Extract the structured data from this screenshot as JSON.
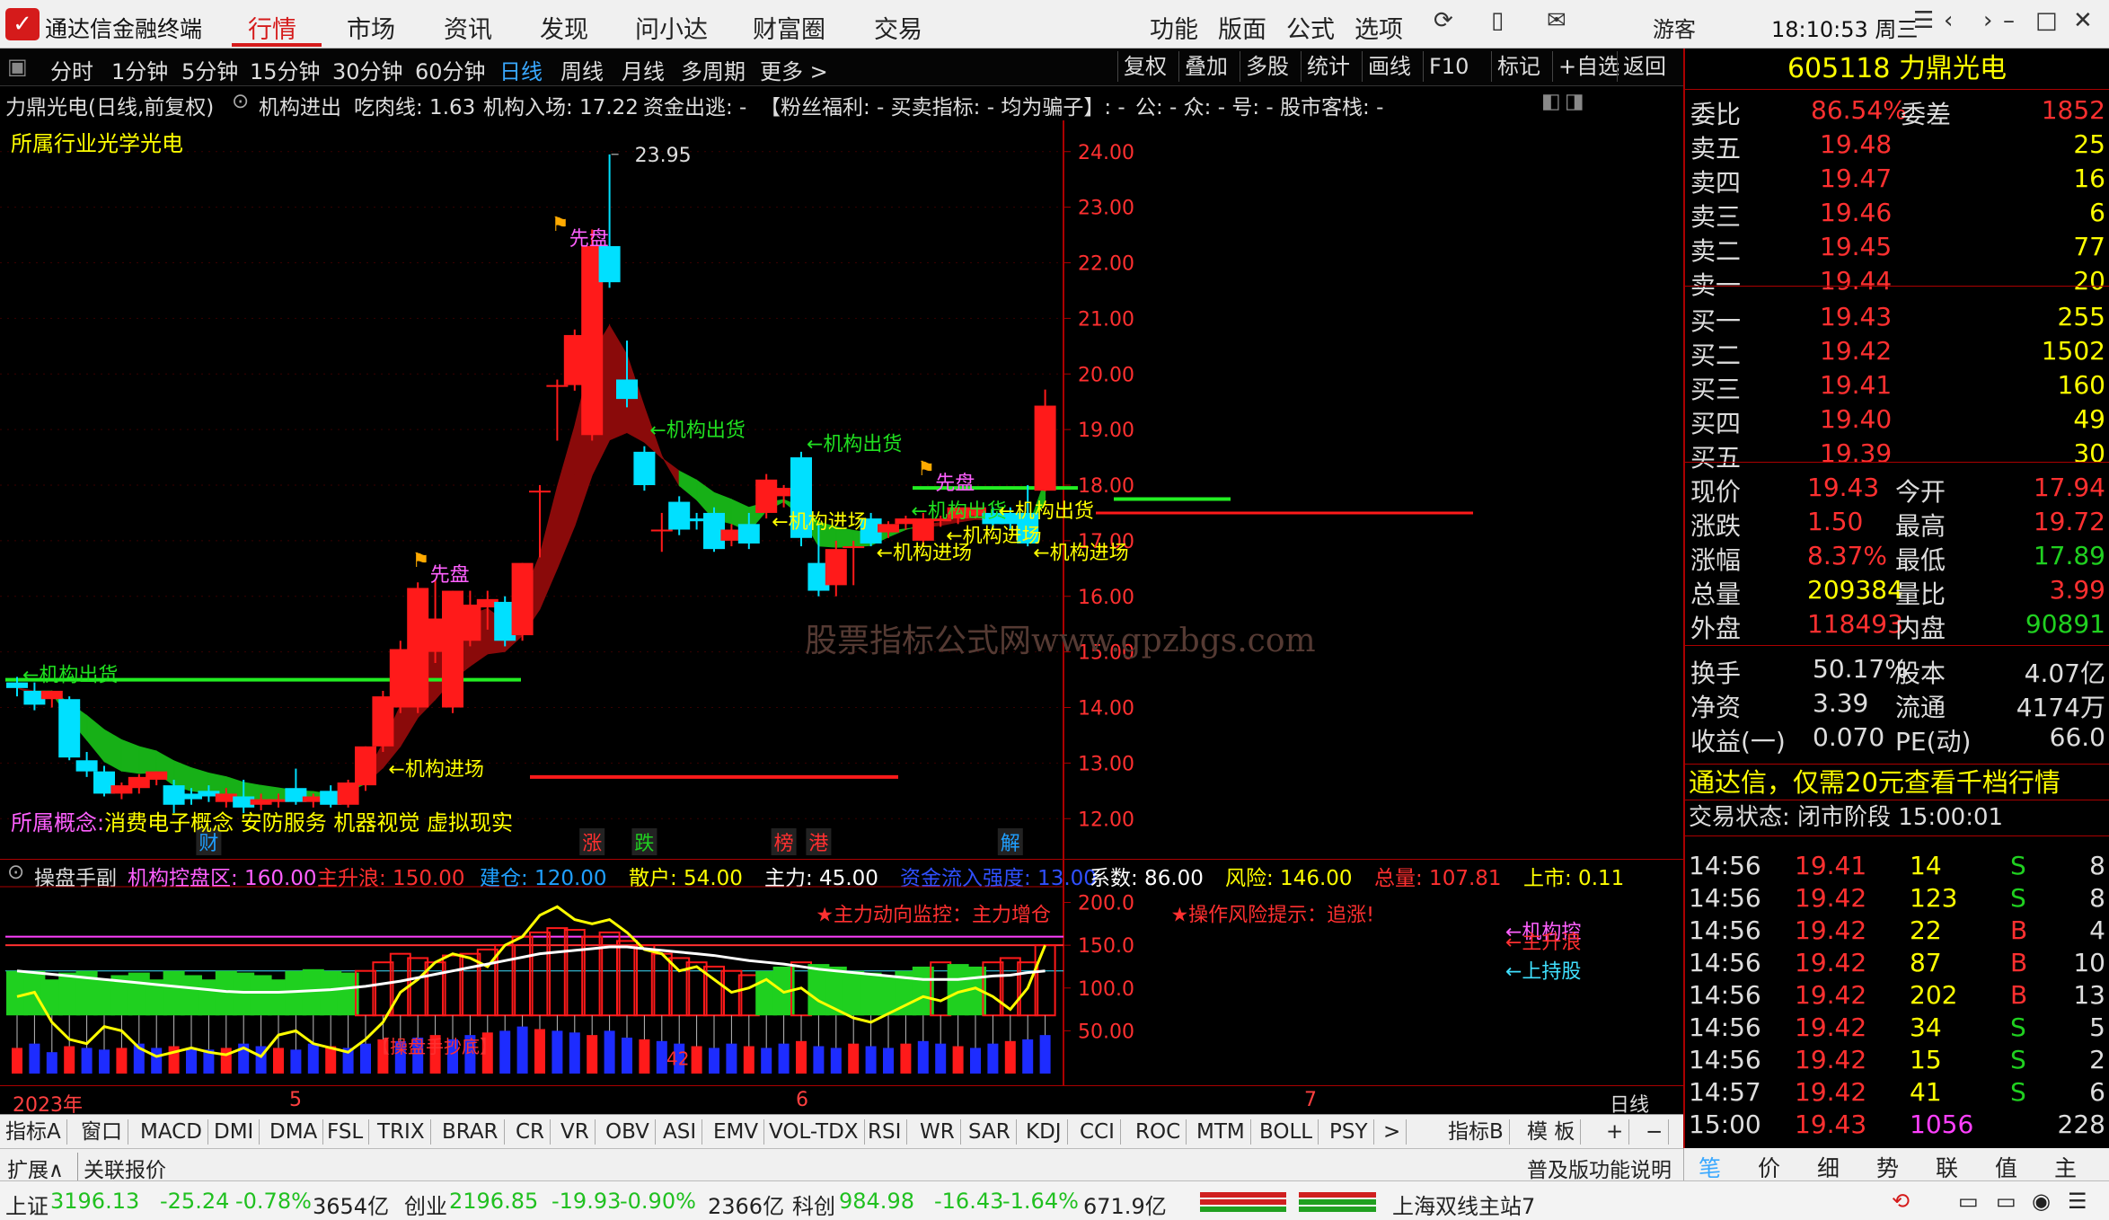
{
  "app": {
    "name": "通达信金融终端",
    "menus": [
      "行情",
      "市场",
      "资讯",
      "发现",
      "问小达",
      "财富圈",
      "交易"
    ],
    "right_menus": [
      "功能",
      "版面",
      "公式",
      "选项"
    ],
    "user": "游客",
    "clock": "18:10:53 周三"
  },
  "chart_toolbar": {
    "periods": [
      "分时",
      "1分钟",
      "5分钟",
      "15分钟",
      "30分钟",
      "60分钟",
      "日线",
      "周线",
      "月线",
      "多周期",
      "更多 >"
    ],
    "selected_period": "日线",
    "right_buttons": [
      "复权",
      "叠加",
      "多股",
      "统计",
      "画线",
      "F10",
      "标记",
      "+自选",
      "返回"
    ]
  },
  "info_line": {
    "stock": "力鼎光电(日线,前复权)",
    "indicator": "机构进出",
    "items": [
      {
        "text": "吃肉线: 1.63",
        "color": "#ffffff"
      },
      {
        "text": "机构入场: 17.22",
        "color": "#ff3030"
      },
      {
        "text": "资金出逃: -",
        "color": "#20d020"
      },
      {
        "text": "【粉丝福利: - 买卖指标: - 均为骗子】: -",
        "color": "#ffff00"
      },
      {
        "text": "公: - 众: - 号: - 股市客栈: -",
        "color": "#ffffff"
      }
    ],
    "industry": "所属行业光学光电",
    "concept_label": "所属概念:",
    "concepts": "消费电子概念 安防服务 机器视觉 虚拟现实"
  },
  "chart_data": [
    {
      "type": "candlestick",
      "title": "力鼎光电(日线,前复权)",
      "y_ticks": [
        24.0,
        23.0,
        22.0,
        21.0,
        20.0,
        19.0,
        18.0,
        17.0,
        16.0,
        15.0,
        14.0,
        13.0,
        12.0
      ],
      "y_tick_labels": [
        "24.00",
        "23.00",
        "22.00",
        "21.00",
        "20.00",
        "19.00",
        "18.00",
        "17.00",
        "16.00",
        "15.00",
        "14.00",
        "13.00",
        "12.00"
      ],
      "ylim": [
        11.6,
        24.4
      ],
      "max_label": "23.95",
      "candles": [
        {
          "o": 14.45,
          "h": 14.55,
          "c": 14.35,
          "l": 14.2
        },
        {
          "o": 14.3,
          "h": 14.45,
          "c": 14.05,
          "l": 13.95
        },
        {
          "o": 14.15,
          "h": 14.3,
          "c": 14.3,
          "l": 14.0
        },
        {
          "o": 14.15,
          "h": 14.2,
          "c": 13.1,
          "l": 13.05
        },
        {
          "o": 13.05,
          "h": 13.2,
          "c": 12.85,
          "l": 12.75
        },
        {
          "o": 12.85,
          "h": 12.95,
          "c": 12.45,
          "l": 12.4
        },
        {
          "o": 12.45,
          "h": 12.65,
          "c": 12.6,
          "l": 12.35
        },
        {
          "o": 12.55,
          "h": 12.8,
          "c": 12.75,
          "l": 12.45
        },
        {
          "o": 12.7,
          "h": 12.85,
          "c": 12.85,
          "l": 12.6
        },
        {
          "o": 12.6,
          "h": 12.7,
          "c": 12.25,
          "l": 12.1
        },
        {
          "o": 12.45,
          "h": 12.55,
          "c": 12.35,
          "l": 12.25
        },
        {
          "o": 12.5,
          "h": 12.6,
          "c": 12.4,
          "l": 12.3
        },
        {
          "o": 12.3,
          "h": 12.55,
          "c": 12.45,
          "l": 12.2
        },
        {
          "o": 12.4,
          "h": 12.7,
          "c": 12.2,
          "l": 12.1
        },
        {
          "o": 12.25,
          "h": 12.45,
          "c": 12.35,
          "l": 12.15
        },
        {
          "o": 12.3,
          "h": 12.45,
          "c": 12.35,
          "l": 12.2
        },
        {
          "o": 12.55,
          "h": 12.9,
          "c": 12.3,
          "l": 12.25
        },
        {
          "o": 12.3,
          "h": 12.45,
          "c": 12.4,
          "l": 12.2
        },
        {
          "o": 12.5,
          "h": 12.6,
          "c": 12.25,
          "l": 12.2
        },
        {
          "o": 12.25,
          "h": 12.7,
          "c": 12.65,
          "l": 12.2
        },
        {
          "o": 12.6,
          "h": 13.3,
          "c": 13.3,
          "l": 12.5
        },
        {
          "o": 13.3,
          "h": 14.3,
          "c": 14.2,
          "l": 13.2
        },
        {
          "o": 14.0,
          "h": 15.2,
          "c": 15.05,
          "l": 13.9
        },
        {
          "o": 14.0,
          "h": 16.25,
          "c": 16.15,
          "l": 13.9
        },
        {
          "o": 15.0,
          "h": 16.3,
          "c": 15.6,
          "l": 14.8
        },
        {
          "o": 14.0,
          "h": 16.1,
          "c": 16.1,
          "l": 13.9
        },
        {
          "o": 15.2,
          "h": 16.1,
          "c": 15.85,
          "l": 15.1
        },
        {
          "o": 15.8,
          "h": 16.1,
          "c": 15.95,
          "l": 15.4
        },
        {
          "o": 15.9,
          "h": 16.0,
          "c": 15.2,
          "l": 15.1
        },
        {
          "o": 15.3,
          "h": 16.6,
          "c": 16.6,
          "l": 15.2
        },
        {
          "o": 17.9,
          "h": 18.0,
          "c": 17.9,
          "l": 16.7
        },
        {
          "o": 19.8,
          "h": 19.9,
          "c": 19.8,
          "l": 18.8
        },
        {
          "o": 19.8,
          "h": 20.8,
          "c": 20.7,
          "l": 19.7
        },
        {
          "o": 18.9,
          "h": 22.6,
          "c": 22.3,
          "l": 18.8
        },
        {
          "o": 22.3,
          "h": 23.95,
          "c": 21.65,
          "l": 21.55
        },
        {
          "o": 19.9,
          "h": 20.6,
          "c": 19.55,
          "l": 19.4
        },
        {
          "o": 18.6,
          "h": 18.7,
          "c": 18.0,
          "l": 17.9
        },
        {
          "o": 17.2,
          "h": 17.5,
          "c": 17.2,
          "l": 16.8
        },
        {
          "o": 17.7,
          "h": 17.8,
          "c": 17.2,
          "l": 17.1
        },
        {
          "o": 17.4,
          "h": 17.5,
          "c": 17.35,
          "l": 17.2
        },
        {
          "o": 17.5,
          "h": 17.6,
          "c": 16.85,
          "l": 16.8
        },
        {
          "o": 17.0,
          "h": 17.3,
          "c": 17.2,
          "l": 16.9
        },
        {
          "o": 17.3,
          "h": 17.5,
          "c": 16.95,
          "l": 16.85
        },
        {
          "o": 17.5,
          "h": 18.2,
          "c": 18.1,
          "l": 17.4
        },
        {
          "o": 17.8,
          "h": 18.0,
          "c": 17.95,
          "l": 17.6
        },
        {
          "o": 18.5,
          "h": 18.6,
          "c": 17.05,
          "l": 16.9
        },
        {
          "o": 16.6,
          "h": 17.3,
          "c": 16.1,
          "l": 16.0
        },
        {
          "o": 16.2,
          "h": 17.0,
          "c": 16.85,
          "l": 16.0
        },
        {
          "o": 16.9,
          "h": 17.0,
          "c": 16.9,
          "l": 16.2
        },
        {
          "o": 17.4,
          "h": 17.5,
          "c": 16.95,
          "l": 16.9
        },
        {
          "o": 17.15,
          "h": 17.35,
          "c": 17.3,
          "l": 17.05
        },
        {
          "o": 17.3,
          "h": 17.45,
          "c": 17.4,
          "l": 17.2
        },
        {
          "o": 17.0,
          "h": 17.5,
          "c": 17.4,
          "l": 16.9
        },
        {
          "o": 17.35,
          "h": 17.45,
          "c": 17.4,
          "l": 17.25
        },
        {
          "o": 17.4,
          "h": 17.6,
          "c": 17.6,
          "l": 17.3
        },
        {
          "o": 17.45,
          "h": 17.6,
          "c": 17.6,
          "l": 17.4
        },
        {
          "o": 17.5,
          "h": 17.6,
          "c": 17.3,
          "l": 17.2
        },
        {
          "o": 17.5,
          "h": 17.6,
          "c": 17.3,
          "l": 17.2
        },
        {
          "o": 17.5,
          "h": 18.0,
          "c": 16.95,
          "l": 16.9
        },
        {
          "o": 17.9,
          "h": 19.72,
          "c": 19.43,
          "l": 17.89
        }
      ],
      "annotations": [
        {
          "text": "←机构出货",
          "color": "#20e020",
          "i": 0,
          "y": 14.6
        },
        {
          "text": "←机构进场",
          "color": "#ffff00",
          "i": 21,
          "y": 12.9
        },
        {
          "text": "←机构出货",
          "color": "#20e020",
          "i": 36,
          "y": 19.0
        },
        {
          "text": "←机构出货",
          "color": "#20e020",
          "i": 45,
          "y": 18.75
        },
        {
          "text": "←机构进场",
          "color": "#ffff00",
          "i": 43,
          "y": 17.35
        },
        {
          "text": "←机构进场",
          "color": "#ffff00",
          "i": 49,
          "y": 16.8
        },
        {
          "text": "←机构出货",
          "color": "#20e020",
          "i": 51,
          "y": 17.55
        },
        {
          "text": "←机构进场",
          "color": "#ffff00",
          "i": 53,
          "y": 17.1
        },
        {
          "text": "←机构出货",
          "color": "#ffff00",
          "i": 56,
          "y": 17.55
        },
        {
          "text": "←机构进场",
          "color": "#ffff00",
          "i": 58,
          "y": 16.8
        }
      ],
      "flags": [
        {
          "text": "先盘",
          "i": 24,
          "y": 16.3,
          "color": "#ff60ff"
        },
        {
          "text": "先盘",
          "i": 32,
          "y": 22.35,
          "color": "#ff60ff"
        },
        {
          "text": "先盘",
          "i": 53,
          "y": 17.95,
          "color": "#ff60ff"
        }
      ],
      "markers": [
        {
          "text": "财",
          "i": 11,
          "color": "#20a0ff"
        },
        {
          "text": "涨",
          "i": 33,
          "color": "#ff3030"
        },
        {
          "text": "跌",
          "i": 36,
          "color": "#20d020"
        },
        {
          "text": "榜",
          "i": 44,
          "color": "#ff3030"
        },
        {
          "text": "港",
          "i": 46,
          "color": "#ff3030"
        },
        {
          "text": "解",
          "i": 57,
          "color": "#20a0ff"
        }
      ],
      "watermark": "股票指标公式网www.gpzbgs.com"
    },
    {
      "type": "bar",
      "title": "操盘手副",
      "y_tick_labels": [
        "200.0",
        "150.0",
        "100.0",
        "50.00"
      ],
      "ylim": [
        0,
        210
      ],
      "header": [
        {
          "text": "机构控盘区: 160.00",
          "color": "#ff60ff"
        },
        {
          "text": "主升浪: 150.00",
          "color": "#ff3030"
        },
        {
          "text": "建仓: 120.00",
          "color": "#20a0ff"
        },
        {
          "text": "散户: 54.00",
          "color": "#ffff00"
        },
        {
          "text": "主力: 45.00",
          "color": "#ffffff"
        },
        {
          "text": "资金流入强度: 13.00",
          "color": "#3050ff"
        },
        {
          "text": "系数: 86.00",
          "color": "#ffffff"
        },
        {
          "text": "风险: 146.00",
          "color": "#ffff00"
        },
        {
          "text": "总量: 107.81",
          "color": "#ff3030"
        },
        {
          "text": "上市: 0.11",
          "color": "#ffff00"
        }
      ],
      "notes": [
        {
          "text": "★主力动向监控：主力增仓",
          "color": "#ff3030"
        },
        {
          "text": "★操作风险提示：追涨!",
          "color": "#ff3030"
        },
        {
          "text": "←机构控",
          "color": "#ff60ff"
        },
        {
          "text": "←主升浪",
          "color": "#ff3030"
        },
        {
          "text": "←上持股",
          "color": "#40e0ff"
        },
        {
          "text": "42",
          "color": "#ff3030"
        },
        {
          "text": "【操盘手抄底】",
          "color": "#ff3030"
        }
      ],
      "values": [
        120,
        120,
        110,
        118,
        120,
        110,
        115,
        118,
        110,
        120,
        115,
        110,
        120,
        118,
        115,
        110,
        120,
        122,
        120,
        118,
        120,
        130,
        140,
        135,
        130,
        138,
        140,
        145,
        150,
        160,
        165,
        170,
        168,
        160,
        165,
        155,
        150,
        140,
        135,
        130,
        125,
        120,
        115,
        120,
        125,
        130,
        128,
        125,
        120,
        118,
        115,
        120,
        125,
        130,
        128,
        125,
        130,
        135,
        130,
        150
      ],
      "intensity": [
        30,
        35,
        25,
        32,
        30,
        28,
        30,
        35,
        30,
        32,
        30,
        28,
        30,
        35,
        32,
        30,
        28,
        35,
        32,
        30,
        35,
        40,
        38,
        42,
        45,
        40,
        45,
        48,
        50,
        55,
        52,
        50,
        48,
        45,
        50,
        42,
        40,
        38,
        35,
        32,
        30,
        35,
        32,
        30,
        35,
        38,
        32,
        30,
        35,
        32,
        30,
        35,
        38,
        35,
        32,
        30,
        35,
        38,
        40,
        45
      ],
      "yellow": [
        90,
        95,
        60,
        40,
        35,
        55,
        50,
        30,
        20,
        25,
        30,
        25,
        22,
        30,
        20,
        45,
        50,
        35,
        30,
        25,
        40,
        60,
        95,
        110,
        130,
        140,
        135,
        125,
        150,
        160,
        185,
        195,
        180,
        175,
        180,
        165,
        145,
        140,
        120,
        125,
        110,
        95,
        100,
        110,
        95,
        100,
        85,
        75,
        65,
        60,
        70,
        80,
        90,
        85,
        95,
        100,
        90,
        75,
        100,
        150
      ],
      "white": [
        120,
        118,
        116,
        114,
        112,
        110,
        108,
        106,
        104,
        102,
        100,
        98,
        96,
        95,
        95,
        95,
        96,
        97,
        98,
        100,
        102,
        105,
        108,
        112,
        116,
        120,
        124,
        128,
        132,
        136,
        140,
        142,
        144,
        146,
        148,
        148,
        146,
        144,
        142,
        140,
        138,
        135,
        132,
        130,
        128,
        125,
        122,
        120,
        118,
        116,
        114,
        112,
        110,
        110,
        110,
        112,
        114,
        115,
        118,
        120
      ]
    }
  ],
  "time_axis": {
    "labels": [
      "2023年",
      "5",
      "6",
      "7"
    ],
    "period": "日线"
  },
  "indicator_tabs": [
    "指标A",
    "窗口",
    "MACD",
    "DMI",
    "DMA",
    "FSL",
    "TRIX",
    "BRAR",
    "CR",
    "VR",
    "OBV",
    "ASI",
    "EMV",
    "VOL-TDX",
    "RSI",
    "WR",
    "SAR",
    "KDJ",
    "CCI",
    "ROC",
    "MTM",
    "BOLL",
    "PSY",
    ">"
  ],
  "indicator_right": [
    "指标B",
    "模 板",
    "+",
    "−"
  ],
  "ext_bar": {
    "left": [
      "扩展∧",
      "关联报价"
    ],
    "right": "普及版功能说明"
  },
  "right_panel": {
    "code": "605118",
    "name": "力鼎光电",
    "weibi_label": "委比",
    "weibi": "86.54%",
    "weicha_label": "委差",
    "weicha": "1852",
    "asks": [
      {
        "label": "卖五",
        "price": "19.48",
        "vol": "25"
      },
      {
        "label": "卖四",
        "price": "19.47",
        "vol": "16"
      },
      {
        "label": "卖三",
        "price": "19.46",
        "vol": "6"
      },
      {
        "label": "卖二",
        "price": "19.45",
        "vol": "77"
      },
      {
        "label": "卖一",
        "price": "19.44",
        "vol": "20"
      }
    ],
    "bids": [
      {
        "label": "买一",
        "price": "19.43",
        "vol": "255"
      },
      {
        "label": "买二",
        "price": "19.42",
        "vol": "1502"
      },
      {
        "label": "买三",
        "price": "19.41",
        "vol": "160"
      },
      {
        "label": "买四",
        "price": "19.40",
        "vol": "49"
      },
      {
        "label": "买五",
        "price": "19.39",
        "vol": "30"
      }
    ],
    "quote": [
      {
        "l1": "现价",
        "v1": "19.43",
        "c1": "#ff3030",
        "l2": "今开",
        "v2": "17.94",
        "c2": "#ff3030"
      },
      {
        "l1": "涨跌",
        "v1": "1.50",
        "c1": "#ff3030",
        "l2": "最高",
        "v2": "19.72",
        "c2": "#ff3030"
      },
      {
        "l1": "涨幅",
        "v1": "8.37%",
        "c1": "#ff3030",
        "l2": "最低",
        "v2": "17.89",
        "c2": "#20d020"
      },
      {
        "l1": "总量",
        "v1": "209384",
        "c1": "#ffff00",
        "l2": "量比",
        "v2": "3.99",
        "c2": "#ff3030"
      },
      {
        "l1": "外盘",
        "v1": "118493",
        "c1": "#ff3030",
        "l2": "内盘",
        "v2": "90891",
        "c2": "#20d020"
      }
    ],
    "fundamentals": [
      {
        "l1": "换手",
        "v1": "50.17%",
        "l2": "股本",
        "v2": "4.07亿"
      },
      {
        "l1": "净资",
        "v1": "3.39",
        "l2": "流通",
        "v2": "4174万"
      },
      {
        "l1": "收益(一)",
        "v1": "0.070",
        "l2": "PE(动)",
        "v2": "66.0"
      }
    ],
    "promo": "通达信，仅需20元查看千档行情",
    "trade_status": "交易状态: 闭市阶段 15:00:01",
    "ticks": [
      {
        "t": "14:56",
        "p": "19.41",
        "v": "14",
        "d": "S",
        "n": "8"
      },
      {
        "t": "14:56",
        "p": "19.42",
        "v": "123",
        "d": "S",
        "n": "8"
      },
      {
        "t": "14:56",
        "p": "19.42",
        "v": "22",
        "d": "B",
        "n": "4"
      },
      {
        "t": "14:56",
        "p": "19.42",
        "v": "87",
        "d": "B",
        "n": "10"
      },
      {
        "t": "14:56",
        "p": "19.42",
        "v": "202",
        "d": "B",
        "n": "13"
      },
      {
        "t": "14:56",
        "p": "19.42",
        "v": "34",
        "d": "S",
        "n": "5"
      },
      {
        "t": "14:56",
        "p": "19.42",
        "v": "15",
        "d": "S",
        "n": "2"
      },
      {
        "t": "14:57",
        "p": "19.42",
        "v": "41",
        "d": "S",
        "n": "6"
      },
      {
        "t": "15:00",
        "p": "19.43",
        "v": "1056",
        "d": "",
        "n": "228"
      }
    ],
    "tabs": [
      "笔",
      "价",
      "细",
      "势",
      "联",
      "值",
      "主"
    ]
  },
  "status_bar": {
    "sh": {
      "name": "上证",
      "value": "3196.13",
      "change": "-25.24",
      "pct": "-0.78%",
      "amount": "3654亿"
    },
    "cy": {
      "name": "创业",
      "value": "2196.85",
      "change": "-19.93",
      "pct": "-0.90%",
      "amount": "2366亿"
    },
    "kc": {
      "name": "科创",
      "value": "984.98",
      "change": "-16.43",
      "pct": "-1.64%",
      "amount": "671.9亿"
    },
    "server": "上海双线主站7"
  }
}
